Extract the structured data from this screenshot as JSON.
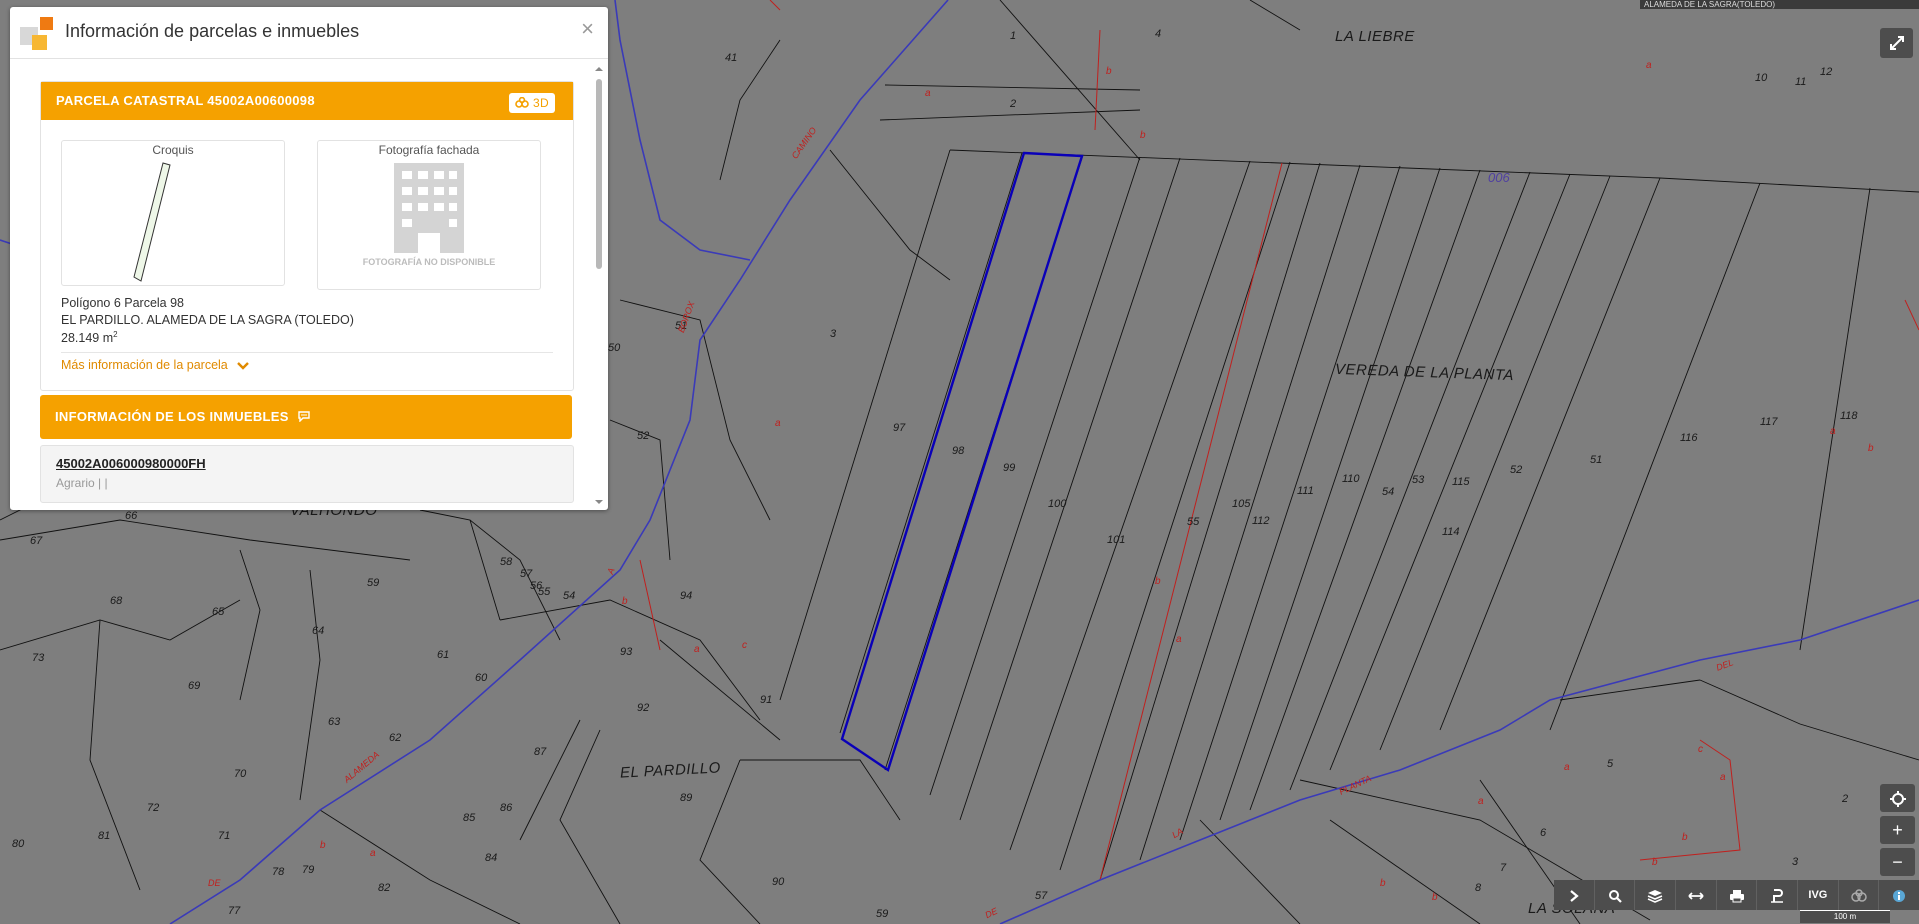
{
  "panel": {
    "title": "Información de parcelas e inmuebles",
    "close_symbol": "×",
    "parcel_header": "PARCELA CATASTRAL 45002A00600098",
    "btn_3d": "3D",
    "croquis_label": "Croquis",
    "photo_label": "Fotografía fachada",
    "photo_unavailable": "FOTOGRAFÍA NO DISPONIBLE",
    "poligono": "Polígono 6 Parcela 98",
    "location": "EL PARDILLO. ALAMEDA DE LA SAGRA (TOLEDO)",
    "area_value": "28.149 m",
    "area_sup": "2",
    "more_info": "Más información de la parcela",
    "inmuebles_header": "INFORMACIÓN DE LOS INMUEBLES",
    "inmueble_ref": "45002A006000980000FH",
    "inmueble_use": "Agrario | |"
  },
  "map": {
    "top_label": "ALAMEDA DE LA SAGRA(TOLEDO)",
    "place_labels": [
      "LA LIEBRE",
      "VEREDA DE LA PLANTA",
      "EL PARDILLO",
      "VALHONDO",
      "LA SOLANA"
    ],
    "polygon_code": "006",
    "road_labels": [
      "CAMINO",
      "BOROX",
      "ALAMEDA",
      "DE",
      "LA",
      "PLANTA",
      "DEL",
      "A",
      "DE"
    ],
    "parcel_numbers": [
      "1",
      "4",
      "41",
      "2",
      "10",
      "11",
      "12",
      "3",
      "51",
      "50",
      "52",
      "97",
      "98",
      "99",
      "100",
      "101",
      "105",
      "112",
      "111",
      "110",
      "54",
      "53",
      "115",
      "114",
      "52",
      "51",
      "116",
      "117",
      "118",
      "55",
      "66",
      "67",
      "68",
      "65",
      "64",
      "59",
      "58",
      "57",
      "56",
      "55",
      "54",
      "94",
      "73",
      "69",
      "61",
      "60",
      "93",
      "92",
      "91",
      "63",
      "62",
      "87",
      "70",
      "72",
      "71",
      "86",
      "85",
      "84",
      "89",
      "80",
      "81",
      "78",
      "79",
      "82",
      "77",
      "90",
      "57",
      "59",
      "5",
      "6",
      "7",
      "8",
      "2",
      "3"
    ],
    "subparcel_letters": [
      "a",
      "b",
      "c"
    ],
    "scale_label": "100 m"
  },
  "controls": {
    "expand_icon": "expand-icon",
    "locate_icon": "crosshair-icon",
    "zoom_in": "+",
    "zoom_out": "−",
    "toolbar": [
      "chevron-right-icon",
      "search-icon",
      "layers-icon",
      "measure-icon",
      "print-icon",
      "parcel-pin-icon",
      "IVG",
      "3d-icon",
      "info-icon"
    ],
    "ivg_label": "IVG"
  },
  "colors": {
    "accent": "#f5a100",
    "map_bg": "#7f7f7f",
    "selected_parcel": "#0a00b8",
    "boundary_red": "#c0201e"
  }
}
